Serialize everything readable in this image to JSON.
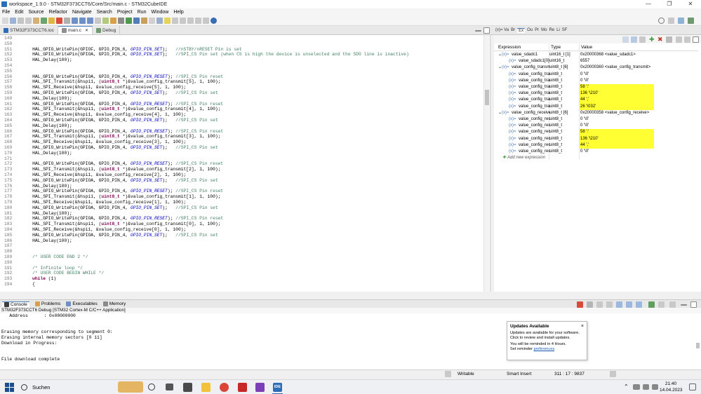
{
  "window": {
    "title": "workspace_1.9.0 - STM32F373CCT6/Core/Src/main.c - STM32CubeIDE",
    "controls": [
      "—",
      "❐",
      "✕"
    ]
  },
  "menu": [
    "File",
    "Edit",
    "Source",
    "Refactor",
    "Navigate",
    "Search",
    "Project",
    "Run",
    "Window",
    "Help"
  ],
  "editor_tabs": [
    {
      "label": "STM32F373CCT6.ioc"
    },
    {
      "label": "main.c",
      "close": "✕"
    },
    {
      "label": "Debug"
    }
  ],
  "code": [
    {
      "n": "149",
      "t": ""
    },
    {
      "n": "150",
      "t": ""
    },
    {
      "n": "151",
      "t": "    HAL_GPIO_WritePin(GPIOF, GPIO_PIN_6, GPIO_PIN_SET);   //nSTBY/nRESET Pin is set"
    },
    {
      "n": "152",
      "t": "    HAL_GPIO_WritePin(GPIOA, GPIO_PIN_4, GPIO_PIN_SET);   //SPI_CS Pin set (when CS is high the device is unselected and the SDO line is inactive)"
    },
    {
      "n": "153",
      "t": "    HAL_Delay(100);"
    },
    {
      "n": "154",
      "t": ""
    },
    {
      "n": "155",
      "t": ""
    },
    {
      "n": "156",
      "t": "    HAL_GPIO_WritePin(GPIOA, GPIO_PIN_4, GPIO_PIN_RESET); //SPI_CS Pin reset"
    },
    {
      "n": "157",
      "t": "    HAL_SPI_Transmit(&hspi1, (uint8_t *)&value_config_transmit[5], 1, 100);"
    },
    {
      "n": "158",
      "t": "    HAL_SPI_Receive(&hspi1, &value_config_receive[5], 1, 100);"
    },
    {
      "n": "159",
      "t": "    HAL_GPIO_WritePin(GPIOA, GPIO_PIN_4, GPIO_PIN_SET);   //SPI_CS Pin set"
    },
    {
      "n": "160",
      "t": "    HAL_Delay(100);"
    },
    {
      "n": "161",
      "t": "    HAL_GPIO_WritePin(GPIOA, GPIO_PIN_4, GPIO_PIN_RESET); //SPI_CS Pin reset"
    },
    {
      "n": "162",
      "t": "    HAL_SPI_Transmit(&hspi1, (uint8_t *)&value_config_transmit[4], 1, 100);"
    },
    {
      "n": "163",
      "t": "    HAL_SPI_Receive(&hspi1, &value_config_receive[4], 1, 100);"
    },
    {
      "n": "164",
      "t": "    HAL_GPIO_WritePin(GPIOA, GPIO_PIN_4, GPIO_PIN_SET);   //SPI_CS Pin set"
    },
    {
      "n": "165",
      "t": "    HAL_Delay(100);"
    },
    {
      "n": "166",
      "t": "    HAL_GPIO_WritePin(GPIOA, GPIO_PIN_4, GPIO_PIN_RESET); //SPI_CS Pin reset"
    },
    {
      "n": "167",
      "t": "    HAL_SPI_Transmit(&hspi1, (uint8_t *)&value_config_transmit[3], 1, 100);"
    },
    {
      "n": "168",
      "t": "    HAL_SPI_Receive(&hspi1, &value_config_receive[3], 1, 100);"
    },
    {
      "n": "169",
      "t": "    HAL_GPIO_WritePin(GPIOA, GPIO_PIN_4, GPIO_PIN_SET);   //SPI_CS Pin set"
    },
    {
      "n": "170",
      "t": "    HAL_Delay(100);"
    },
    {
      "n": "171",
      "t": ""
    },
    {
      "n": "172",
      "t": "    HAL_GPIO_WritePin(GPIOA, GPIO_PIN_4, GPIO_PIN_RESET); //SPI_CS Pin reset"
    },
    {
      "n": "173",
      "t": "    HAL_SPI_Transmit(&hspi1, (uint8_t *)&value_config_transmit[2], 1, 100);"
    },
    {
      "n": "174",
      "t": "    HAL_SPI_Receive(&hspi1, &value_config_receive[2], 1, 100);"
    },
    {
      "n": "175",
      "t": "    HAL_GPIO_WritePin(GPIOA, GPIO_PIN_4, GPIO_PIN_SET);   //SPI_CS Pin set"
    },
    {
      "n": "176",
      "t": "    HAL_Delay(100);"
    },
    {
      "n": "177",
      "t": "    HAL_GPIO_WritePin(GPIOA, GPIO_PIN_4, GPIO_PIN_RESET); //SPI_CS Pin reset"
    },
    {
      "n": "178",
      "t": "    HAL_SPI_Transmit(&hspi1, (uint8_t *)&value_config_transmit[1], 1, 100);"
    },
    {
      "n": "179",
      "t": "    HAL_SPI_Receive(&hspi1, &value_config_receive[1], 1, 100);"
    },
    {
      "n": "180",
      "t": "    HAL_GPIO_WritePin(GPIOA, GPIO_PIN_4, GPIO_PIN_SET);   //SPI_CS Pin set"
    },
    {
      "n": "181",
      "t": "    HAL_Delay(100);"
    },
    {
      "n": "182",
      "t": "    HAL_GPIO_WritePin(GPIOA, GPIO_PIN_4, GPIO_PIN_RESET); //SPI_CS Pin reset"
    },
    {
      "n": "183",
      "t": "    HAL_SPI_Transmit(&hspi1, (uint8_t *)&value_config_transmit[0], 1, 100);"
    },
    {
      "n": "184",
      "t": "    HAL_SPI_Receive(&hspi1, &value_config_receive[0], 1, 100);"
    },
    {
      "n": "185",
      "t": "    HAL_GPIO_WritePin(GPIOA, GPIO_PIN_4, GPIO_PIN_SET);   //SPI_CS Pin set"
    },
    {
      "n": "186",
      "t": "    HAL_Delay(100);"
    },
    {
      "n": "187",
      "t": ""
    },
    {
      "n": "188",
      "t": ""
    },
    {
      "n": "189",
      "t": "    /* USER CODE END 2 */"
    },
    {
      "n": "190",
      "t": ""
    },
    {
      "n": "191",
      "t": "    /* Infinite loop */"
    },
    {
      "n": "192",
      "t": "    /* USER CODE BEGIN WHILE */"
    },
    {
      "n": "193",
      "t": "    while (1)"
    },
    {
      "n": "194",
      "t": "    {"
    }
  ],
  "right_tabs": [
    "(x)= Va",
    "Br",
    "Ex",
    "Ou",
    "Pr",
    "Mo",
    "Re",
    "Li",
    "SF"
  ],
  "expressions": {
    "headers": [
      "Expression",
      "Type",
      "Value"
    ],
    "rows": [
      {
        "indent": 0,
        "toggle": "⌄",
        "icon": "(x)=",
        "expr": "value_sdadc1",
        "type": "uint16_t [1]",
        "value": "0x20000368 <value_sdadc1>",
        "hl": false
      },
      {
        "indent": 1,
        "toggle": "",
        "icon": "(x)=",
        "expr": "value_sdadc1[0]",
        "type": "uint16_t",
        "value": "6557",
        "hl": false
      },
      {
        "indent": 0,
        "toggle": "⌄",
        "icon": "(x)=",
        "expr": "value_config_transmit",
        "type": "uint8_t [6]",
        "value": "0x20000360 <value_config_transmit>",
        "hl": false
      },
      {
        "indent": 1,
        "toggle": "",
        "icon": "(x)=",
        "expr": "value_config_transmit[0]",
        "type": "uint8_t",
        "value": "0 '\\0'",
        "hl": false
      },
      {
        "indent": 1,
        "toggle": "",
        "icon": "(x)=",
        "expr": "value_config_transmit[1]",
        "type": "uint8_t",
        "value": "0 '\\0'",
        "hl": false
      },
      {
        "indent": 1,
        "toggle": "",
        "icon": "(x)=",
        "expr": "value_config_transmit[2]",
        "type": "uint8_t",
        "value": "58 ':'",
        "hl": true
      },
      {
        "indent": 1,
        "toggle": "",
        "icon": "(x)=",
        "expr": "value_config_transmit[3]",
        "type": "uint8_t",
        "value": "136 '\\210'",
        "hl": true
      },
      {
        "indent": 1,
        "toggle": "",
        "icon": "(x)=",
        "expr": "value_config_transmit[4]",
        "type": "uint8_t",
        "value": "44 ','",
        "hl": true
      },
      {
        "indent": 1,
        "toggle": "",
        "icon": "(x)=",
        "expr": "value_config_transmit[5]",
        "type": "uint8_t",
        "value": "26 '\\032'",
        "hl": true
      },
      {
        "indent": 0,
        "toggle": "⌄",
        "icon": "(x)=",
        "expr": "value_config_receive",
        "type": "uint8_t [6]",
        "value": "0x20000358 <value_config_receive>",
        "hl": false
      },
      {
        "indent": 1,
        "toggle": "",
        "icon": "(x)=",
        "expr": "value_config_receive[0]",
        "type": "uint8_t",
        "value": "0 '\\0'",
        "hl": false
      },
      {
        "indent": 1,
        "toggle": "",
        "icon": "(x)=",
        "expr": "value_config_receive[1]",
        "type": "uint8_t",
        "value": "0 '\\0'",
        "hl": false
      },
      {
        "indent": 1,
        "toggle": "",
        "icon": "(x)=",
        "expr": "value_config_receive[2]",
        "type": "uint8_t",
        "value": "58 ':'",
        "hl": true
      },
      {
        "indent": 1,
        "toggle": "",
        "icon": "(x)=",
        "expr": "value_config_receive[3]",
        "type": "uint8_t",
        "value": "136 '\\210'",
        "hl": true
      },
      {
        "indent": 1,
        "toggle": "",
        "icon": "(x)=",
        "expr": "value_config_receive[4]",
        "type": "uint8_t",
        "value": "44 ','",
        "hl": true
      },
      {
        "indent": 1,
        "toggle": "",
        "icon": "(x)=",
        "expr": "value_config_receive[5]",
        "type": "uint8_t",
        "value": "0 '\\0'",
        "hl": false
      }
    ],
    "add_new": "Add new expression"
  },
  "console_tabs": [
    "Console",
    "Problems",
    "Executables",
    "Memory"
  ],
  "console_title": "STM32F373CCT6 Debug [STM32 Cortex-M C/C++ Application]",
  "console_lines": [
    "   Address      : 0x08000000",
    "",
    "",
    "Erasing memory corresponding to segment 0:",
    "Erasing internal memory sectors [0 11]",
    "Download in Progress:",
    "",
    "",
    "File download complete"
  ],
  "notification": {
    "title": "Updates Available",
    "close": "×",
    "line1": "Updates are available for your software.",
    "line2": "Click to review and install updates.",
    "line3": "You will be reminded in 4 Hours.",
    "line4_prefix": "Set reminder ",
    "line4_link": "preferences"
  },
  "status": {
    "mode1": "Writable",
    "mode2": "Smart Insert",
    "pos": "311 : 17 : 9837"
  },
  "taskbar": {
    "search": "Suchen",
    "ide_label": "IDE",
    "time": "21:40",
    "date": "14.04.2023"
  }
}
